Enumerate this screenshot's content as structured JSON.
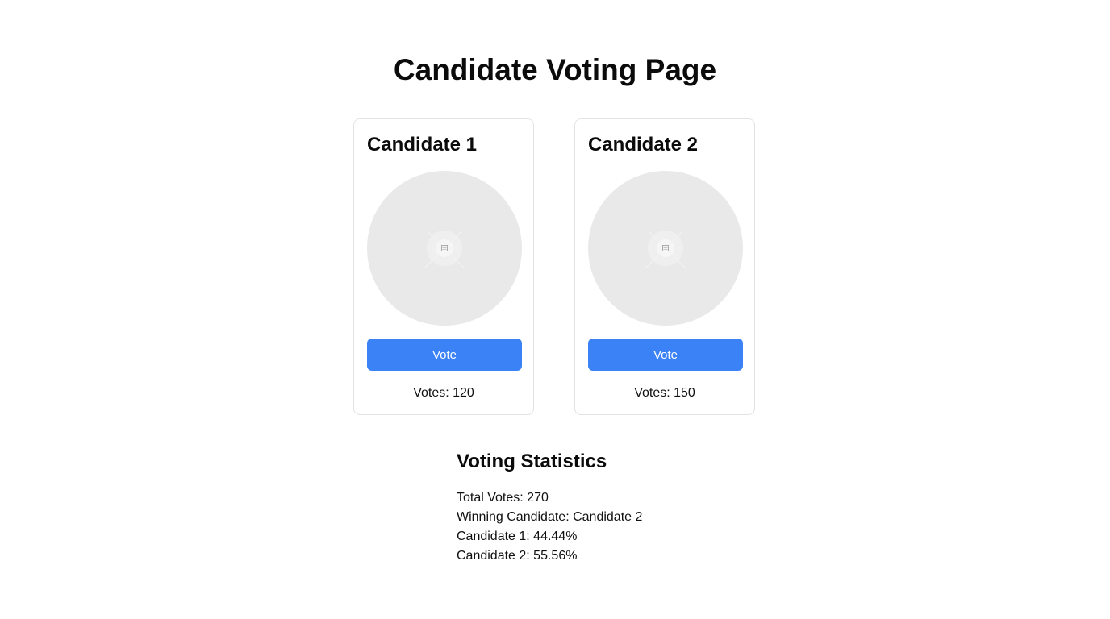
{
  "page": {
    "title": "Candidate Voting Page"
  },
  "candidates": [
    {
      "name": "Candidate 1",
      "vote_button_label": "Vote",
      "votes_text": "Votes: 120",
      "votes": 120,
      "avatar_icon": "image-placeholder-icon"
    },
    {
      "name": "Candidate 2",
      "vote_button_label": "Vote",
      "votes_text": "Votes: 150",
      "votes": 150,
      "avatar_icon": "image-placeholder-icon"
    }
  ],
  "statistics": {
    "title": "Voting Statistics",
    "lines": [
      "Total Votes: 270",
      "Winning Candidate: Candidate 2",
      "Candidate 1: 44.44%",
      "Candidate 2: 55.56%"
    ]
  },
  "colors": {
    "accent": "#3b82f6",
    "avatar_bg": "#e9e9e9",
    "card_border": "#e3e3e3",
    "text": "#111111"
  }
}
